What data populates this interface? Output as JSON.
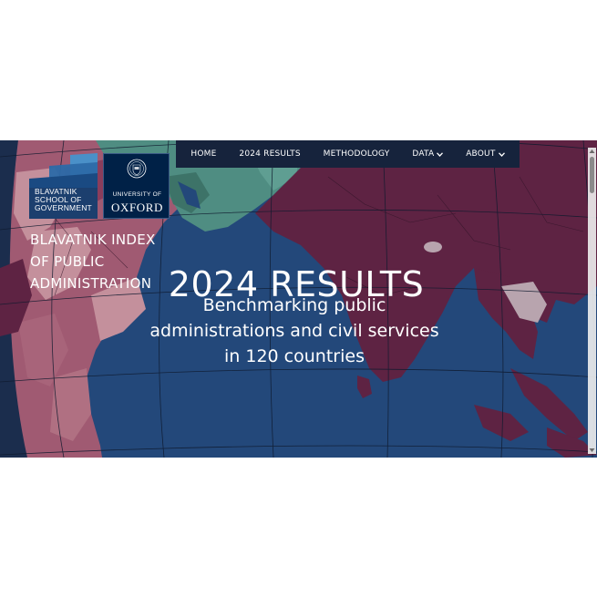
{
  "logos": {
    "blavatnik": {
      "lines": [
        "BLAVATNIK",
        "SCHOOL OF",
        "GOVERNMENT"
      ],
      "colors": [
        "#4a90c8",
        "#2c6aa8",
        "#1a4a82"
      ]
    },
    "oxford": {
      "univ_line": "UNIVERSITY OF",
      "name_line": "OXFORD",
      "bg": "#002147"
    }
  },
  "nav": {
    "items": [
      {
        "label": "HOME",
        "has_dropdown": false
      },
      {
        "label": "2024 RESULTS",
        "has_dropdown": false
      },
      {
        "label": "METHODOLOGY",
        "has_dropdown": false
      },
      {
        "label": "DATA",
        "has_dropdown": true
      },
      {
        "label": "ABOUT",
        "has_dropdown": true
      }
    ],
    "bg": "#16233c"
  },
  "hero": {
    "index_title_lines": [
      "BLAVATNIK INDEX",
      "OF PUBLIC",
      "ADMINISTRATION"
    ],
    "main_title": "2024 RESULTS",
    "subtitle_lines": [
      "Benchmarking public",
      "administrations and civil services",
      "in 120 countries"
    ],
    "colors": {
      "ocean": "#23487a",
      "land_dark": "#5e2343",
      "land_pink": "#a05a72",
      "land_light_pink": "#c4909c",
      "land_teal": "#4f8d82",
      "land_gray": "#b8a4ae"
    }
  }
}
